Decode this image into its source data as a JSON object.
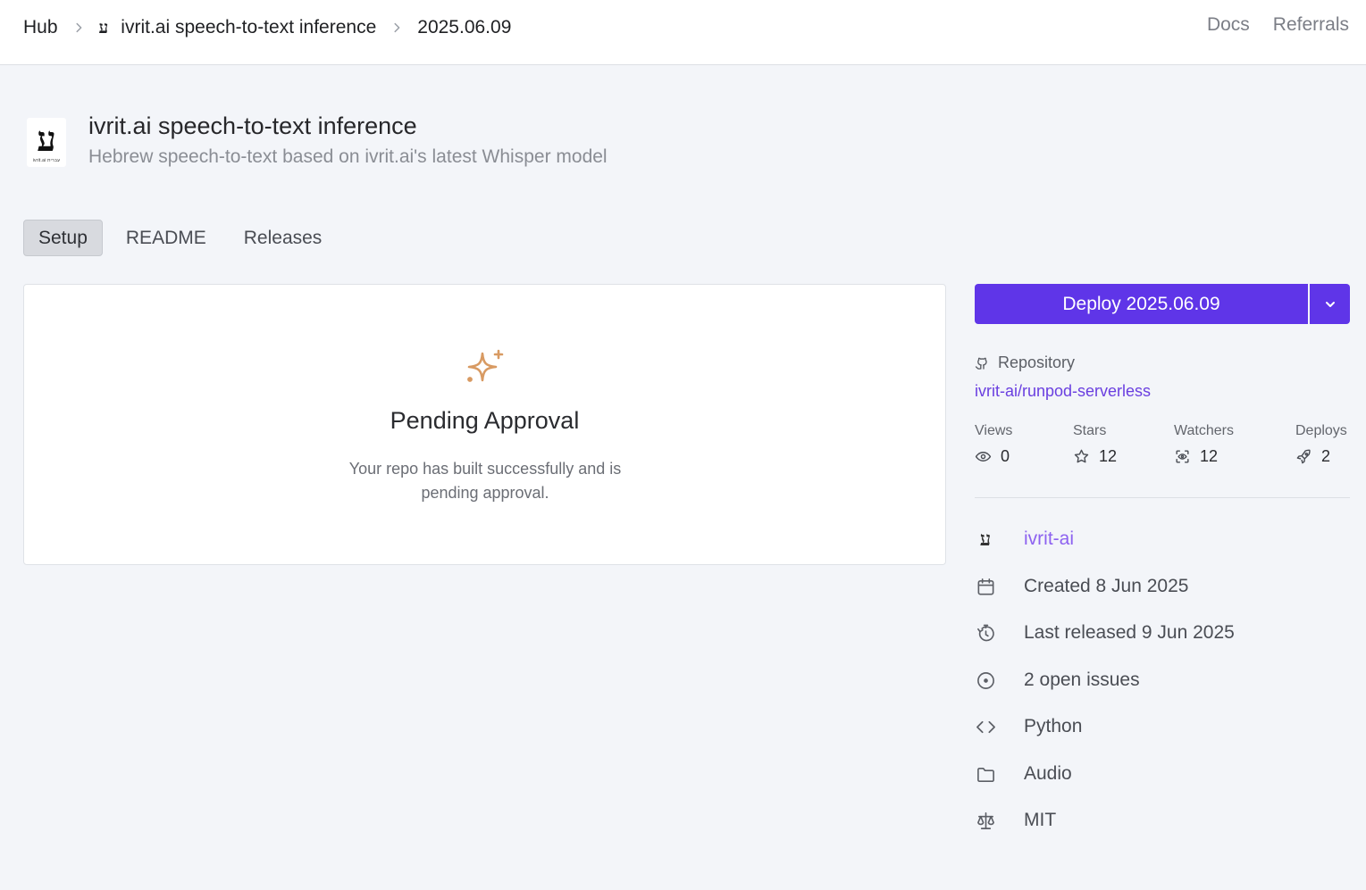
{
  "breadcrumb": {
    "hub": "Hub",
    "repo": "ivrit.ai speech-to-text inference",
    "version": "2025.06.09",
    "repo_logo_glyph": "ע"
  },
  "topnav": {
    "docs": "Docs",
    "referrals": "Referrals"
  },
  "header": {
    "logo_glyph": "ע",
    "logo_caption": "ivrit.ai עברית",
    "title": "ivrit.ai speech-to-text inference",
    "subtitle": "Hebrew speech-to-text based on ivrit.ai's latest Whisper model"
  },
  "tabs": [
    {
      "label": "Setup",
      "active": true
    },
    {
      "label": "README",
      "active": false
    },
    {
      "label": "Releases",
      "active": false
    }
  ],
  "status_card": {
    "icon": "sparkle-icon",
    "title": "Pending Approval",
    "message": "Your repo has built successfully and is pending approval."
  },
  "deploy": {
    "label": "Deploy 2025.06.09"
  },
  "repository": {
    "label": "Repository",
    "link": "ivrit-ai/runpod-serverless"
  },
  "stats": [
    {
      "label": "Views",
      "value": "0",
      "icon": "eye-icon"
    },
    {
      "label": "Stars",
      "value": "12",
      "icon": "star-icon"
    },
    {
      "label": "Watchers",
      "value": "12",
      "icon": "watch-icon"
    },
    {
      "label": "Deploys",
      "value": "2",
      "icon": "rocket-icon"
    }
  ],
  "meta": {
    "owner": "ivrit-ai",
    "owner_logo_glyph": "ע",
    "created": "Created 8 Jun 2025",
    "released": "Last released 9 Jun 2025",
    "issues": "2 open issues",
    "language": "Python",
    "category": "Audio",
    "license": "MIT"
  },
  "colors": {
    "accent": "#5f35e8",
    "link": "#6a3fe0",
    "sparkle": "#d89a62",
    "background": "#f3f5f9"
  }
}
